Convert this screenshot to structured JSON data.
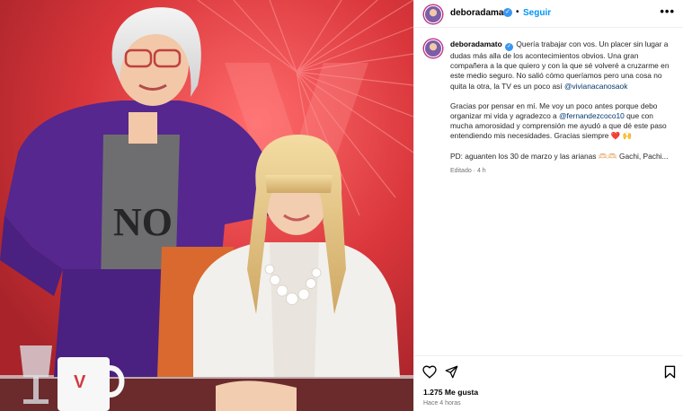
{
  "post": {
    "username": "deboradamato",
    "verified_mark": "✓",
    "separator": "•",
    "follow_label": "Seguir",
    "more_label": "•••"
  },
  "caption": {
    "username": "deboradamato",
    "p1_text": "Quería trabajar con vos. Un placer sin lugar a dudas más alla de los acontecimientos obvios. Una gran compañera a la que quiero y con la que sé volveré a cruzarme en este medio seguro. No salió cómo queríamos pero una cosa no quita la otra, la TV es un poco así ",
    "p1_mention": "@vivianacanosaok",
    "p2_text_a": "Gracias por pensar en mí. Me voy un poco antes porque debo organizar mi vida y agradezco a ",
    "p2_mention": "@fernandezcoco10",
    "p2_text_b": " que con mucha amorosidad y comprensión me ayudó a que dé este paso entendiendo mis necesidades. Gracias siempre ❤️ 🙌",
    "p3_text": "PD: aguanten los 30 de marzo y las arianas 🫶🏻🫶🏻 Gachi, Pachi...",
    "edited_label": "Editado · 4 h"
  },
  "stats": {
    "likes_label": "1.275 Me gusta",
    "time_label": "Hace 4 horas"
  },
  "photo": {
    "mug_logo": "V"
  },
  "icons": {
    "like": "heart-icon",
    "share": "send-icon",
    "save": "bookmark-icon",
    "more": "more-icon",
    "verified": "verified-badge-icon"
  },
  "colors": {
    "follow": "#0095f6",
    "verified": "#3897f0",
    "mention": "#00376b",
    "muted": "#737373",
    "photo_background": "#d2353a"
  }
}
